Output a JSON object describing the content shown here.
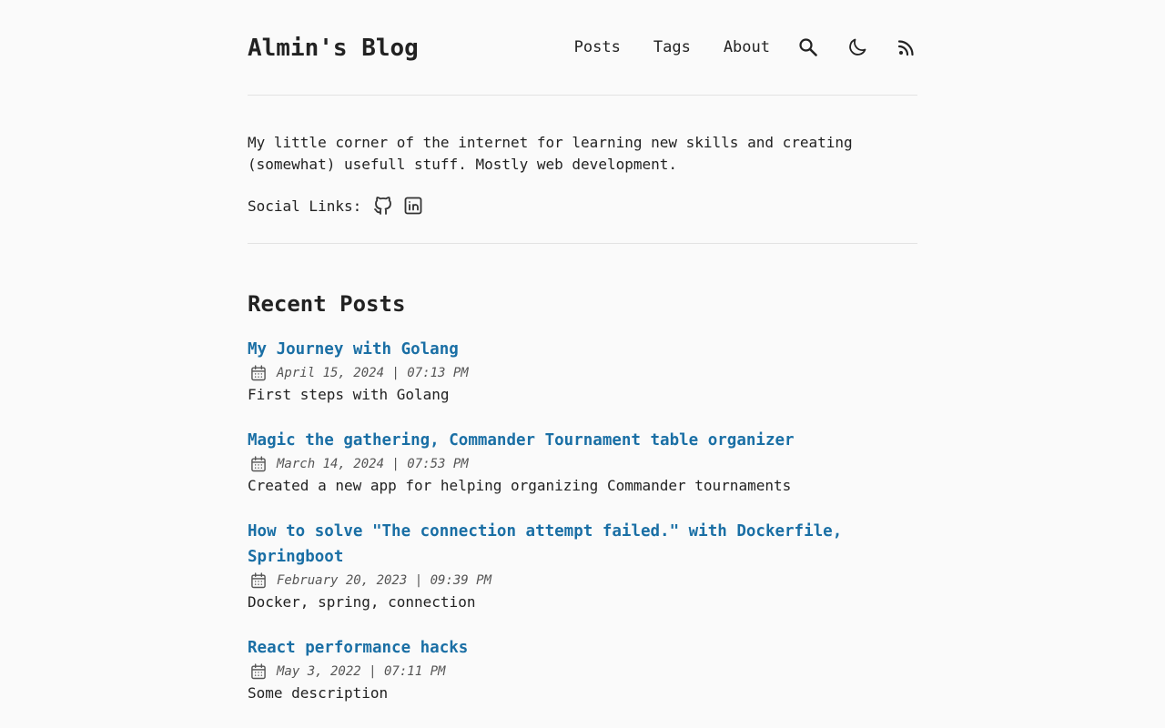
{
  "header": {
    "logo": "Almin's Blog",
    "nav": [
      {
        "label": "Posts"
      },
      {
        "label": "Tags"
      },
      {
        "label": "About"
      }
    ],
    "icons": [
      "search-icon",
      "moon-icon",
      "rss-icon"
    ]
  },
  "intro": {
    "text": "My little corner of the internet for learning new skills and creating (somewhat) usefull stuff. Mostly web development.",
    "social_label": "Social Links:",
    "social_icons": [
      "github-icon",
      "linkedin-icon"
    ]
  },
  "recent": {
    "title": "Recent Posts",
    "posts": [
      {
        "title": "My Journey with Golang",
        "date": "April 15, 2024 | 07:13 PM",
        "description": "First steps with Golang"
      },
      {
        "title": "Magic the gathering, Commander Tournament table organizer",
        "date": "March 14, 2024 | 07:53 PM",
        "description": "Created a new app for helping organizing Commander tournaments"
      },
      {
        "title": "How to solve \"The connection attempt failed.\" with Dockerfile, Springboot",
        "date": "February 20, 2023 | 09:39 PM",
        "description": "Docker, spring, connection"
      },
      {
        "title": "React performance hacks",
        "date": "May 3, 2022 | 07:11 PM",
        "description": "Some description"
      }
    ]
  },
  "colors": {
    "background": "#fafafa",
    "text": "#222222",
    "accent": "#1a6fa5",
    "divider": "#e3e3e3"
  }
}
